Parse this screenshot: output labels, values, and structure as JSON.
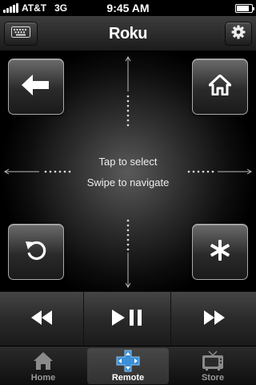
{
  "status_bar": {
    "carrier": "AT&T",
    "network": "3G",
    "time": "9:45 AM",
    "battery_level": 0.85,
    "icons": [
      "signal-icon",
      "battery-icon"
    ]
  },
  "nav_bar": {
    "title": "Roku",
    "left_icon": "keyboard-icon",
    "right_icon": "gear-icon"
  },
  "pad": {
    "hint_select": "Tap to select",
    "hint_navigate": "Swipe to navigate",
    "buttons": {
      "top_left": "back-arrow-icon",
      "top_right": "home-icon",
      "bottom_left": "instant-replay-icon",
      "bottom_right": "asterisk-icon"
    }
  },
  "transport": {
    "buttons": [
      "rewind-icon",
      "play-pause-icon",
      "fast-forward-icon"
    ]
  },
  "tab_bar": {
    "tabs": [
      {
        "label": "Home",
        "icon": "house-icon",
        "active": false
      },
      {
        "label": "Remote",
        "icon": "dpad-icon",
        "active": true
      },
      {
        "label": "Store",
        "icon": "tv-icon",
        "active": false
      }
    ]
  },
  "colors": {
    "background": "#000000",
    "accent_blue": "#3a8fd8",
    "text": "#ffffff",
    "inactive_text": "#999999"
  }
}
